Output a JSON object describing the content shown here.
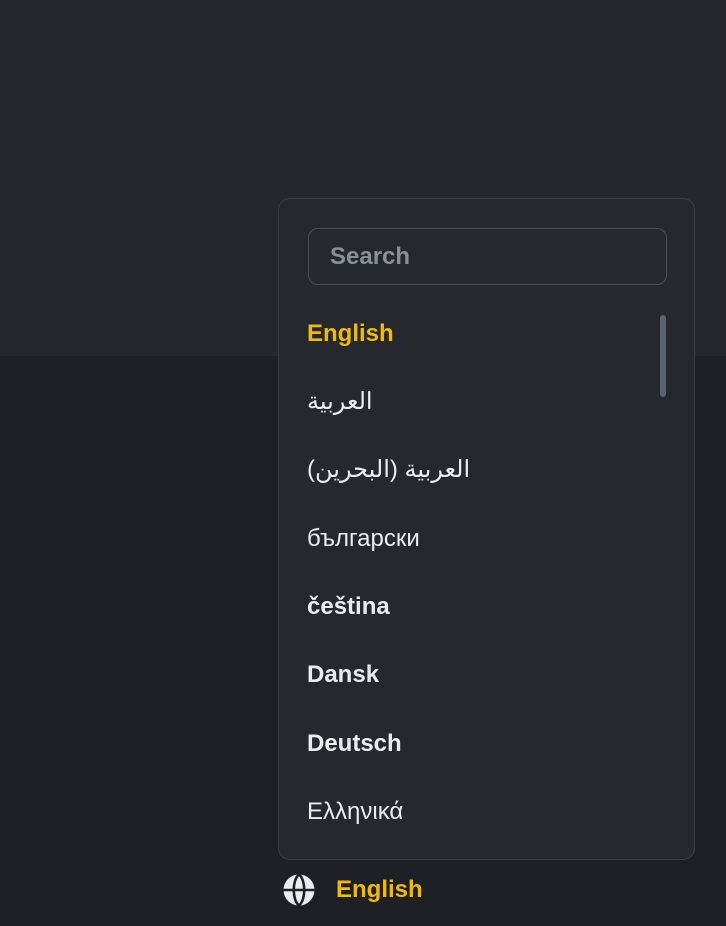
{
  "search": {
    "placeholder": "Search",
    "value": ""
  },
  "languages": [
    {
      "label": "English",
      "selected": true
    },
    {
      "label": "العربية",
      "selected": false
    },
    {
      "label": "العربية (البحرين)",
      "selected": false
    },
    {
      "label": "български",
      "selected": false
    },
    {
      "label": "čeština",
      "selected": false
    },
    {
      "label": "Dansk",
      "selected": false
    },
    {
      "label": "Deutsch",
      "selected": false
    },
    {
      "label": "Ελληνικά",
      "selected": false
    }
  ],
  "footer": {
    "current_language": "English",
    "icon": "globe-icon"
  },
  "colors": {
    "accent": "#f0b90b",
    "text": "#eaecef",
    "panel_bg": "#25282d",
    "page_bg": "#1e2026"
  }
}
